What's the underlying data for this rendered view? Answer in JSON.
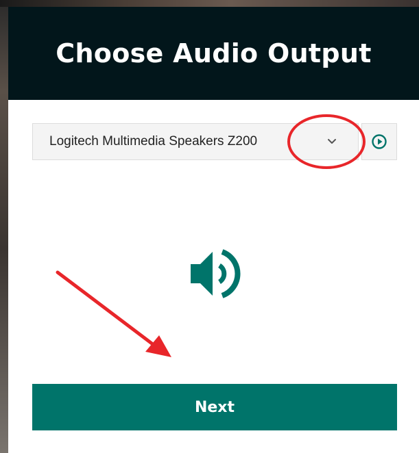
{
  "dialog": {
    "title": "Choose Audio Output"
  },
  "audio_output": {
    "selected_device": "Logitech Multimedia Speakers Z200"
  },
  "buttons": {
    "next_label": "Next"
  },
  "icons": {
    "dropdown": "chevron-down-icon",
    "play": "play-circle-icon",
    "speaker": "speaker-volume-icon"
  },
  "colors": {
    "header_bg": "#02161b",
    "accent": "#00746a",
    "annotation": "#e8262a"
  }
}
